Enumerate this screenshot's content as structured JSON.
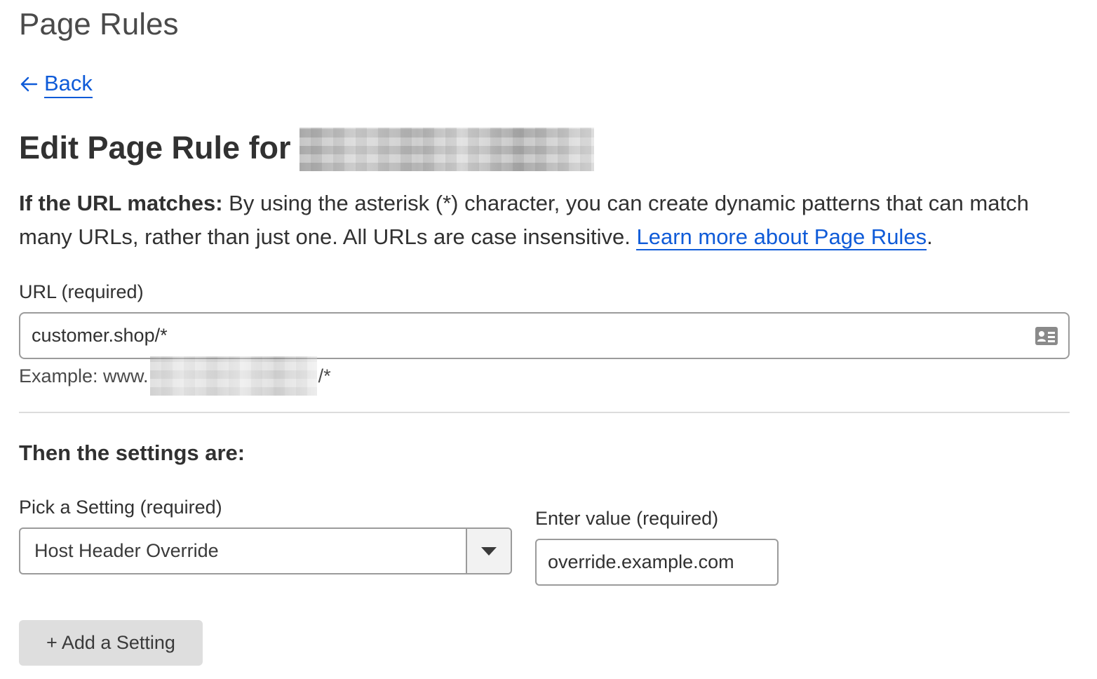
{
  "header": {
    "title": "Page Rules",
    "back_label": "Back"
  },
  "edit": {
    "title_prefix": "Edit Page Rule for"
  },
  "intro": {
    "bold_lead": "If the URL matches:",
    "text": " By using the asterisk (*) character, you can create dynamic patterns that can match many URLs, rather than just one. All URLs are case insensitive. ",
    "link_text": "Learn more about Page Rules",
    "trailing": "."
  },
  "url_field": {
    "label": "URL (required)",
    "value": "customer.shop/*",
    "icon": "contact-card-icon",
    "example_prefix": "Example: www.",
    "example_suffix": "/*"
  },
  "settings": {
    "heading": "Then the settings are:",
    "pick_label": "Pick a Setting (required)",
    "selected_setting": "Host Header Override",
    "value_label": "Enter value (required)",
    "value": "override.example.com",
    "add_button_plus": "+",
    "add_button_label": "Add a Setting"
  },
  "colors": {
    "link": "#0f5bd8",
    "text": "#313131",
    "border": "#9b9b9b",
    "button_bg": "#dedede"
  }
}
